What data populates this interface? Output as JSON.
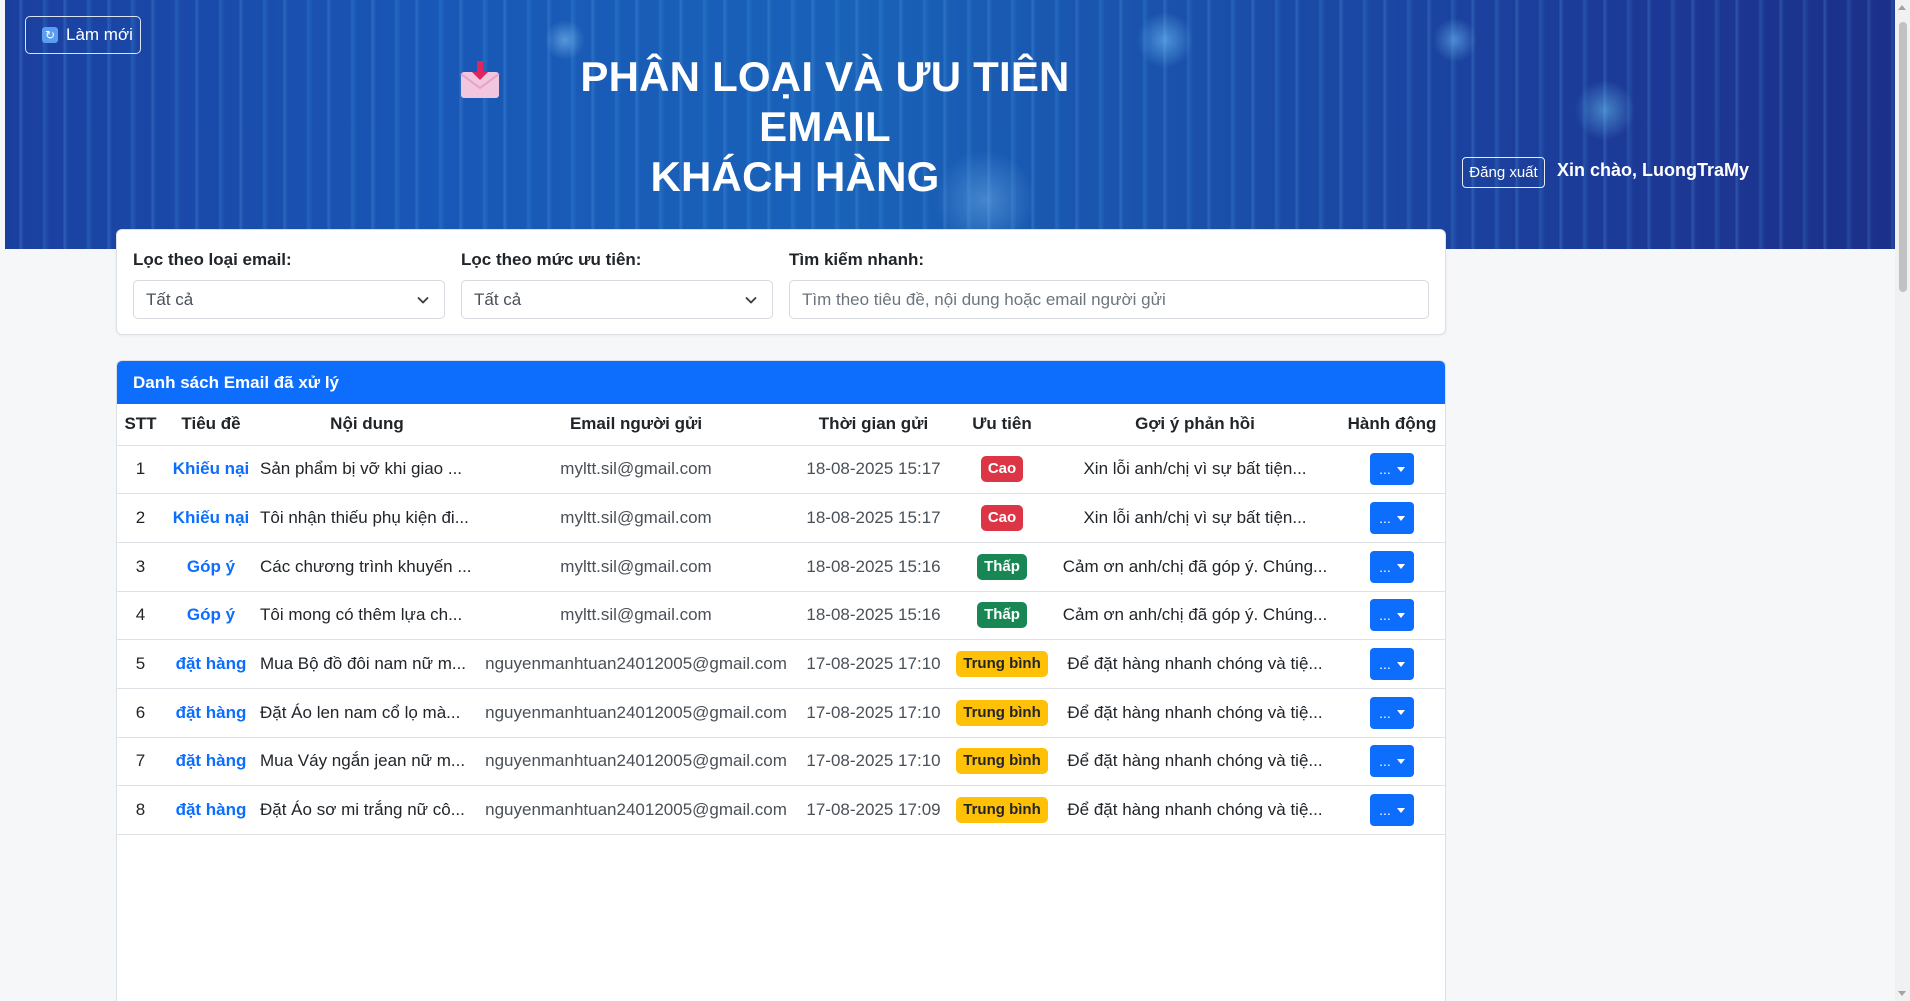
{
  "header": {
    "refresh_label": "Làm mới",
    "refresh_icon": "refresh-icon",
    "title_line1": "PHÂN LOẠI VÀ ƯU TIÊN EMAIL",
    "title_line2": "KHÁCH HÀNG",
    "title_icon": "incoming-envelope-icon",
    "greeting": "Xin chào, LuongTraMy",
    "logout_label": "Đăng xuất"
  },
  "filters": {
    "type_label": "Lọc theo loại email:",
    "type_value": "Tất cả",
    "priority_label": "Lọc theo mức ưu tiên:",
    "priority_value": "Tất cả",
    "search_label": "Tìm kiếm nhanh:",
    "search_placeholder": "Tìm theo tiêu đề, nội dung hoặc email người gửi"
  },
  "table": {
    "title": "Danh sách Email đã xử lý",
    "columns": [
      "STT",
      "Tiêu đề",
      "Nội dung",
      "Email người gửi",
      "Thời gian gửi",
      "Ưu tiên",
      "Gợi ý phản hồi",
      "Hành động"
    ],
    "action_label": "...",
    "priority_colors": {
      "Cao": "#dc3545",
      "Thấp": "#198754",
      "Trung bình": "#ffc107"
    },
    "rows": [
      {
        "stt": "1",
        "type": "Khiếu nại",
        "content": "Sản phẩm bị vỡ khi giao ...",
        "email": "myltt.sil@gmail.com",
        "time": "18-08-2025 15:17",
        "priority": "Cao",
        "priority_level": "high",
        "reply": "Xin lỗi anh/chị vì sự bất tiện..."
      },
      {
        "stt": "2",
        "type": "Khiếu nại",
        "content": "Tôi nhận thiếu phụ kiện đi...",
        "email": "myltt.sil@gmail.com",
        "time": "18-08-2025 15:17",
        "priority": "Cao",
        "priority_level": "high",
        "reply": "Xin lỗi anh/chị vì sự bất tiện..."
      },
      {
        "stt": "3",
        "type": "Góp ý",
        "content": "Các chương trình khuyến ...",
        "email": "myltt.sil@gmail.com",
        "time": "18-08-2025 15:16",
        "priority": "Thấp",
        "priority_level": "low",
        "reply": "Cảm ơn anh/chị đã góp ý. Chúng..."
      },
      {
        "stt": "4",
        "type": "Góp ý",
        "content": "Tôi mong có thêm lựa ch...",
        "email": "myltt.sil@gmail.com",
        "time": "18-08-2025 15:16",
        "priority": "Thấp",
        "priority_level": "low",
        "reply": "Cảm ơn anh/chị đã góp ý. Chúng..."
      },
      {
        "stt": "5",
        "type": "đặt hàng",
        "content": "Mua Bộ đồ đôi nam nữ m...",
        "email": "nguyenmanhtuan24012005@gmail.com",
        "time": "17-08-2025 17:10",
        "priority": "Trung bình",
        "priority_level": "mid",
        "reply": "Để đặt hàng nhanh chóng và tiệ..."
      },
      {
        "stt": "6",
        "type": "đặt hàng",
        "content": "Đặt Áo len nam cổ lọ mà...",
        "email": "nguyenmanhtuan24012005@gmail.com",
        "time": "17-08-2025 17:10",
        "priority": "Trung bình",
        "priority_level": "mid",
        "reply": "Để đặt hàng nhanh chóng và tiệ..."
      },
      {
        "stt": "7",
        "type": "đặt hàng",
        "content": "Mua Váy ngắn jean nữ m...",
        "email": "nguyenmanhtuan24012005@gmail.com",
        "time": "17-08-2025 17:10",
        "priority": "Trung bình",
        "priority_level": "mid",
        "reply": "Để đặt hàng nhanh chóng và tiệ..."
      },
      {
        "stt": "8",
        "type": "đặt hàng",
        "content": "Đặt Áo sơ mi trắng nữ cô...",
        "email": "nguyenmanhtuan24012005@gmail.com",
        "time": "17-08-2025 17:09",
        "priority": "Trung bình",
        "priority_level": "mid",
        "reply": "Để đặt hàng nhanh chóng và tiệ..."
      }
    ]
  }
}
